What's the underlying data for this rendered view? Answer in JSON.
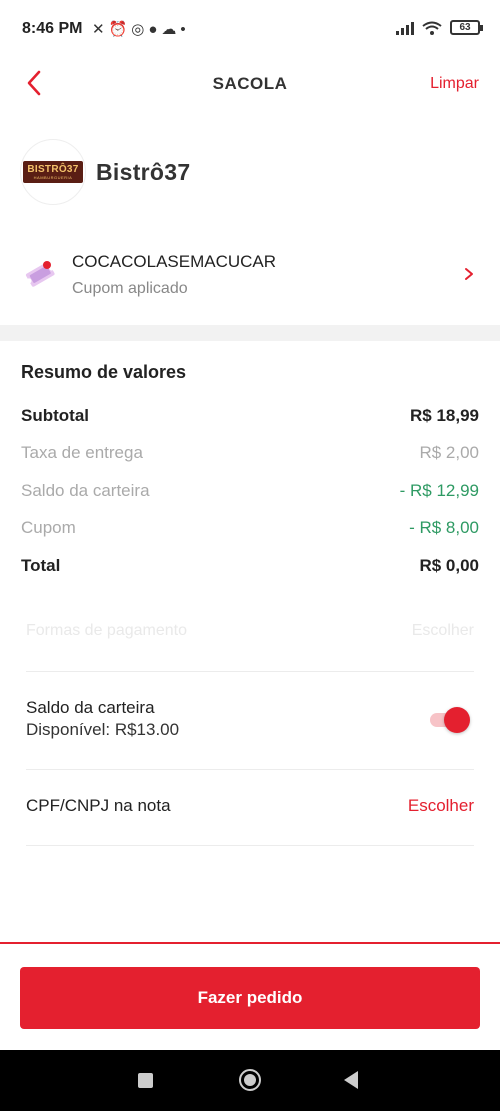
{
  "status_bar": {
    "time": "8:46 PM",
    "icons": [
      "muted-bell-icon",
      "alarm-icon",
      "whatsapp-icon",
      "spotify-icon",
      "cloud-icon",
      "dot-icon"
    ],
    "battery": "63"
  },
  "header": {
    "title": "SACOLA",
    "clear_label": "Limpar"
  },
  "store": {
    "logo_text": "BISTRÔ37",
    "logo_subtext": "HAMBURGUERIA",
    "name": "Bistrô37"
  },
  "coupon": {
    "code": "COCACOLASEMACUCAR",
    "status": "Cupom aplicado"
  },
  "summary": {
    "title": "Resumo de valores",
    "rows": [
      {
        "label": "Subtotal",
        "value": "R$ 18,99"
      },
      {
        "label": "Taxa de entrega",
        "value": "R$ 2,00"
      },
      {
        "label": "Saldo da carteira",
        "value": "- R$ 12,99"
      },
      {
        "label": "Cupom",
        "value": "- R$ 8,00"
      },
      {
        "label": "Total",
        "value": "R$ 0,00"
      }
    ]
  },
  "payment": {
    "label": "Formas de pagamento",
    "action": "Escolher"
  },
  "wallet": {
    "title": "Saldo da carteira",
    "available": "Disponível: R$13.00",
    "enabled": true
  },
  "cpf": {
    "label": "CPF/CNPJ na nota",
    "action": "Escolher"
  },
  "cta": {
    "label": "Fazer pedido"
  },
  "colors": {
    "accent": "#e4202f",
    "discount": "#2e9a63"
  }
}
